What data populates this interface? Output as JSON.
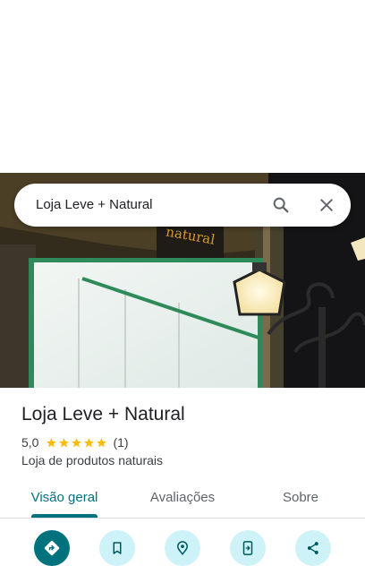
{
  "search": {
    "query": "Loja Leve + Natural"
  },
  "place": {
    "name": "Loja Leve + Natural",
    "rating": "5,0",
    "stars_filled": 5,
    "stars_total": 5,
    "review_count": "(1)",
    "category": "Loja de produtos naturais"
  },
  "tabs": [
    {
      "label": "Visão geral",
      "active": true
    },
    {
      "label": "Avaliações",
      "active": false
    },
    {
      "label": "Sobre",
      "active": false
    }
  ],
  "actions": [
    {
      "icon": "directions-icon"
    },
    {
      "icon": "bookmark-icon"
    },
    {
      "icon": "nearby-icon"
    },
    {
      "icon": "send-to-phone-icon"
    },
    {
      "icon": "share-icon"
    }
  ],
  "colors": {
    "accent": "#00727e",
    "accent_light": "#cdf3f8",
    "star": "#fbbc04",
    "text": "#202124",
    "secondary_text": "#3c4043"
  }
}
